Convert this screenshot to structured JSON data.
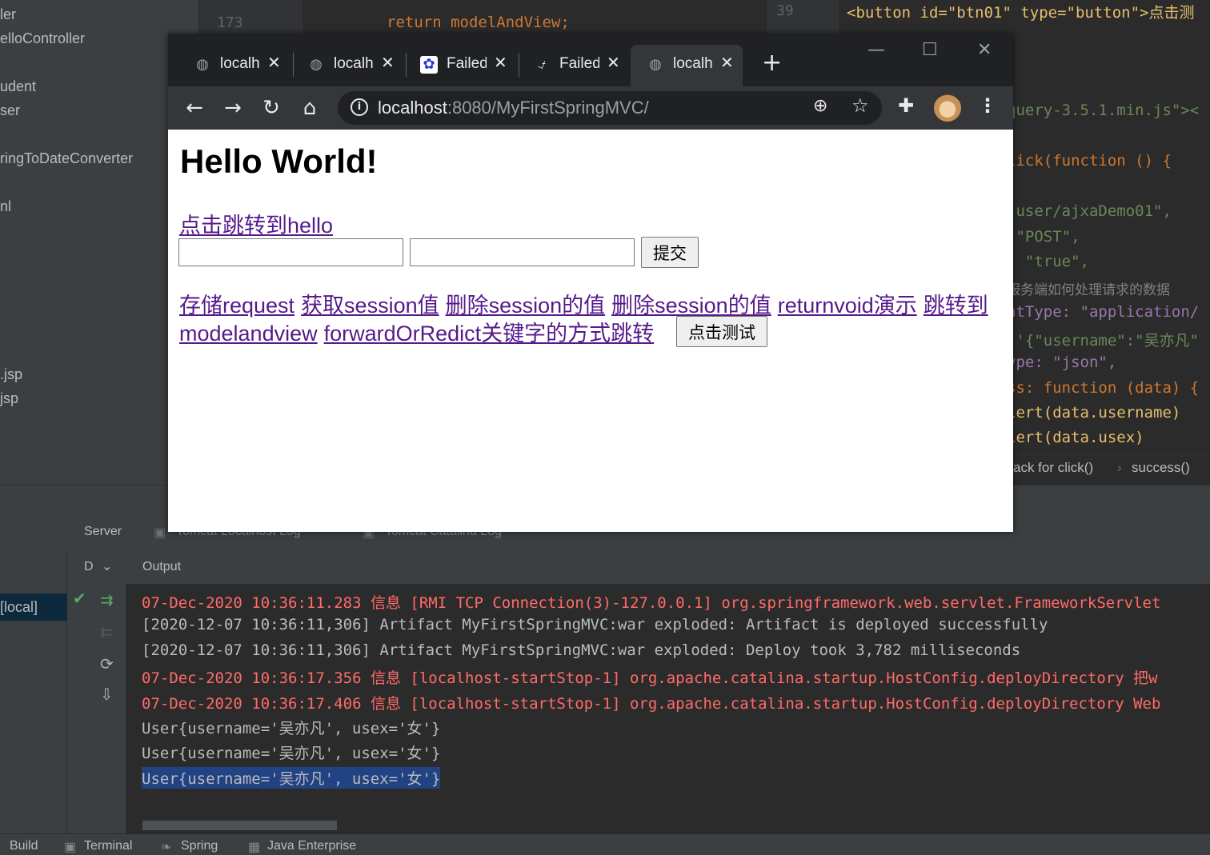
{
  "ide": {
    "project_tree": [
      "ler",
      "elloController",
      "udent",
      "ser",
      "ringToDateConverter",
      "nl",
      ".jsp",
      "jsp"
    ],
    "gutter_numbers": [
      "173",
      "39"
    ],
    "code_top_line": "return modelAndView;",
    "code_right_lines": [
      "<button id=\"btn01\" type=\"button\">点击测",
      "query-3.5.1.min.js\"><",
      "lick(function () {",
      "'user/ajxaDemo01\",",
      " \"POST\",",
      ": \"true\",",
      "服务端如何处理请求的数据",
      "ntType: \"application/",
      " '{\"username\":\"吴亦凡\"",
      "ype: \"json\",",
      "ss: function (data) {",
      "lert(data.username)",
      "lert(data.usex)"
    ],
    "breadcrumb": [
      "ack for click()",
      "success()"
    ],
    "services_tabs": [
      "Server",
      "Tomcat Localhost Log",
      "Tomcat Catalina Log"
    ],
    "output_label": "Output",
    "tree_selected": "[local]",
    "dropdown_label": "D",
    "log_lines": [
      {
        "text": "07-Dec-2020 10:36:11.283 信息 [RMI TCP Connection(3)-127.0.0.1] org.springframework.web.servlet.FrameworkServlet",
        "type": "red"
      },
      {
        "text": "[2020-12-07 10:36:11,306] Artifact MyFirstSpringMVC:war exploded: Artifact is deployed successfully",
        "type": "norm"
      },
      {
        "text": "[2020-12-07 10:36:11,306] Artifact MyFirstSpringMVC:war exploded: Deploy took 3,782 milliseconds",
        "type": "norm"
      },
      {
        "text": "07-Dec-2020 10:36:17.356 信息 [localhost-startStop-1] org.apache.catalina.startup.HostConfig.deployDirectory 把w",
        "type": "red"
      },
      {
        "text": "07-Dec-2020 10:36:17.406 信息 [localhost-startStop-1] org.apache.catalina.startup.HostConfig.deployDirectory Web",
        "type": "red"
      },
      {
        "text": "User{username='吴亦凡', usex='女'}",
        "type": "norm"
      },
      {
        "text": "User{username='吴亦凡', usex='女'}",
        "type": "norm"
      },
      {
        "text": "User{username='吴亦凡', usex='女'}",
        "type": "sel"
      }
    ],
    "statusbar": [
      "Build",
      "Terminal",
      "Spring",
      "Java Enterprise"
    ]
  },
  "browser": {
    "tabs": [
      {
        "title": "localh",
        "icon": "globe-icon"
      },
      {
        "title": "localh",
        "icon": "globe-icon"
      },
      {
        "title": "Failed",
        "icon": "baidu-paw-icon"
      },
      {
        "title": "Failed",
        "icon": "broken-page-icon"
      },
      {
        "title": "localh",
        "icon": "globe-icon"
      }
    ],
    "active_tab": 4,
    "url_host": "localhost",
    "url_path": ":8080/MyFirstSpringMVC/"
  },
  "page": {
    "heading": "Hello World!",
    "link_hello": "点击跳转到hello",
    "input1_value": "",
    "input2_value": "",
    "submit_label": "提交",
    "links_row1": [
      "存储request",
      "获取session值",
      "删除session的值",
      "删除session的值",
      "returnvoid演示",
      "跳转到"
    ],
    "links_row2": [
      "modelandview",
      "forwardOrRedict关键字的方式跳转"
    ],
    "test_button": "点击测试"
  },
  "colors": {
    "ide_bg": "#2b2b2b",
    "ide_panel": "#3c3f41",
    "log_red": "#ff6b68",
    "log_selection": "#214283",
    "visited_link": "#551a8b",
    "chrome_dark": "#202124",
    "chrome_toolbar": "#35363a"
  }
}
